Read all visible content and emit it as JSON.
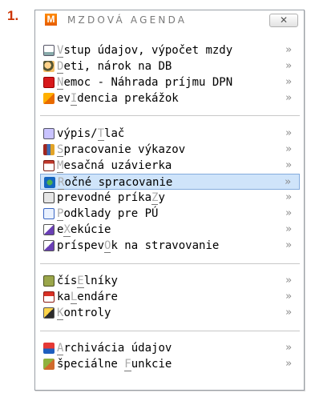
{
  "step_number": "1.",
  "menu": {
    "title": "MZDOVÁ AGENDA",
    "logo_letter": "M",
    "close_symbol": "✕",
    "submenu_arrow": "»",
    "items": [
      {
        "pre": "",
        "mid": "V",
        "post": "stup údajov, výpočet mzdy",
        "icon": "edit-form-icon"
      },
      {
        "pre": "",
        "mid": "D",
        "post": "eti, nárok na DB",
        "icon": "children-icon"
      },
      {
        "pre": "",
        "mid": "N",
        "post": "emoc - Náhrada príjmu DPN",
        "icon": "medical-cross-icon"
      },
      {
        "pre": "ev",
        "mid": "I",
        "post": "dencia prekážok",
        "icon": "orange-flag-icon"
      },
      {
        "pre": "výpis/",
        "mid": "T",
        "post": "lač",
        "icon": "print-icon"
      },
      {
        "pre": "",
        "mid": "S",
        "post": "pracovanie výkazov",
        "icon": "books-icon"
      },
      {
        "pre": "",
        "mid": "M",
        "post": "esačná uzávierka",
        "icon": "calendar-icon"
      },
      {
        "pre": "",
        "mid": "R",
        "post": "očné spracovanie",
        "icon": "globe-icon"
      },
      {
        "pre": "prevodné príka",
        "mid": "Z",
        "post": "y",
        "icon": "bank-icon"
      },
      {
        "pre": "",
        "mid": "P",
        "post": "odklady pre PÚ",
        "icon": "document-search-icon"
      },
      {
        "pre": "e",
        "mid": "X",
        "post": "ekúcie",
        "icon": "signature-icon"
      },
      {
        "pre": "príspev",
        "mid": "O",
        "post": "k na stravovanie",
        "icon": "signature-edit-icon"
      },
      {
        "pre": "čís",
        "mid": "E",
        "post": "lníky",
        "icon": "codebook-icon"
      },
      {
        "pre": "ka",
        "mid": "L",
        "post": "endáre",
        "icon": "calendar-red-icon"
      },
      {
        "pre": "",
        "mid": "K",
        "post": "ontroly",
        "icon": "checklist-icon"
      },
      {
        "pre": "",
        "mid": "A",
        "post": "rchivácia údajov",
        "icon": "floppy-disk-icon"
      },
      {
        "pre": "špeciálne ",
        "mid": "F",
        "post": "unkcie",
        "icon": "tools-icon"
      }
    ],
    "selected_index": 7
  }
}
